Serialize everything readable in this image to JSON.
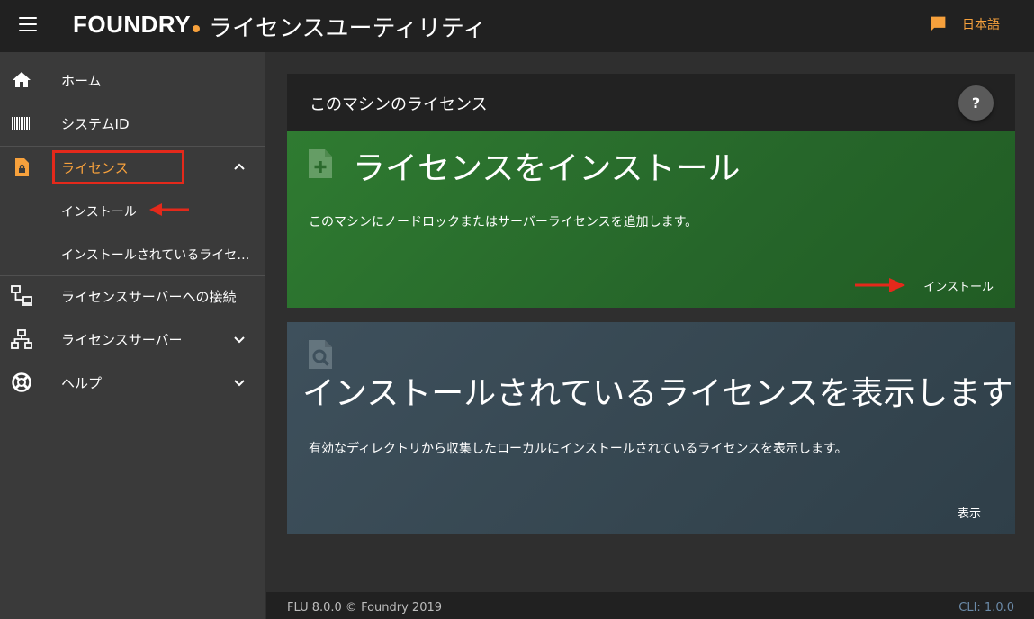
{
  "header": {
    "logo_text": "FOUNDRY",
    "title": "ライセンスユーティリティ",
    "language": "日本語",
    "menu_icon": "hamburger-icon",
    "lang_icon": "chat-bubble-icon"
  },
  "sidebar": {
    "items": [
      {
        "label": "ホーム",
        "icon": "home-icon"
      },
      {
        "label": "システムID",
        "icon": "barcode-icon"
      },
      {
        "label": "ライセンス",
        "icon": "license-file-icon",
        "expanded": true
      },
      {
        "label": "ライセンスサーバーへの接続",
        "icon": "network-connect-icon"
      },
      {
        "label": "ライセンスサーバー",
        "icon": "server-network-icon"
      },
      {
        "label": "ヘルプ",
        "icon": "lifebuoy-icon"
      }
    ],
    "sub_items": [
      {
        "label": "インストール"
      },
      {
        "label": "インストールされているライセンス"
      }
    ]
  },
  "main": {
    "panel_title": "このマシンのライセンス",
    "help_label": "?",
    "install_card": {
      "title": "ライセンスをインストール",
      "description": "このマシンにノードロックまたはサーバーライセンスを追加します。",
      "action": "インストール",
      "icon": "file-plus-icon"
    },
    "view_card": {
      "title": "インストールされているライセンスを表示します",
      "description": "有効なディレクトリから収集したローカルにインストールされているライセンスを表示します。",
      "action": "表示",
      "icon": "file-search-icon"
    }
  },
  "footer": {
    "version": "FLU 8.0.0 © Foundry 2019",
    "cli": "CLI: 1.0.0"
  },
  "colors": {
    "accent": "#f7a13c",
    "annotation_red": "#e4291b",
    "install_card": "#2f7b31",
    "view_card": "#3e505c"
  }
}
